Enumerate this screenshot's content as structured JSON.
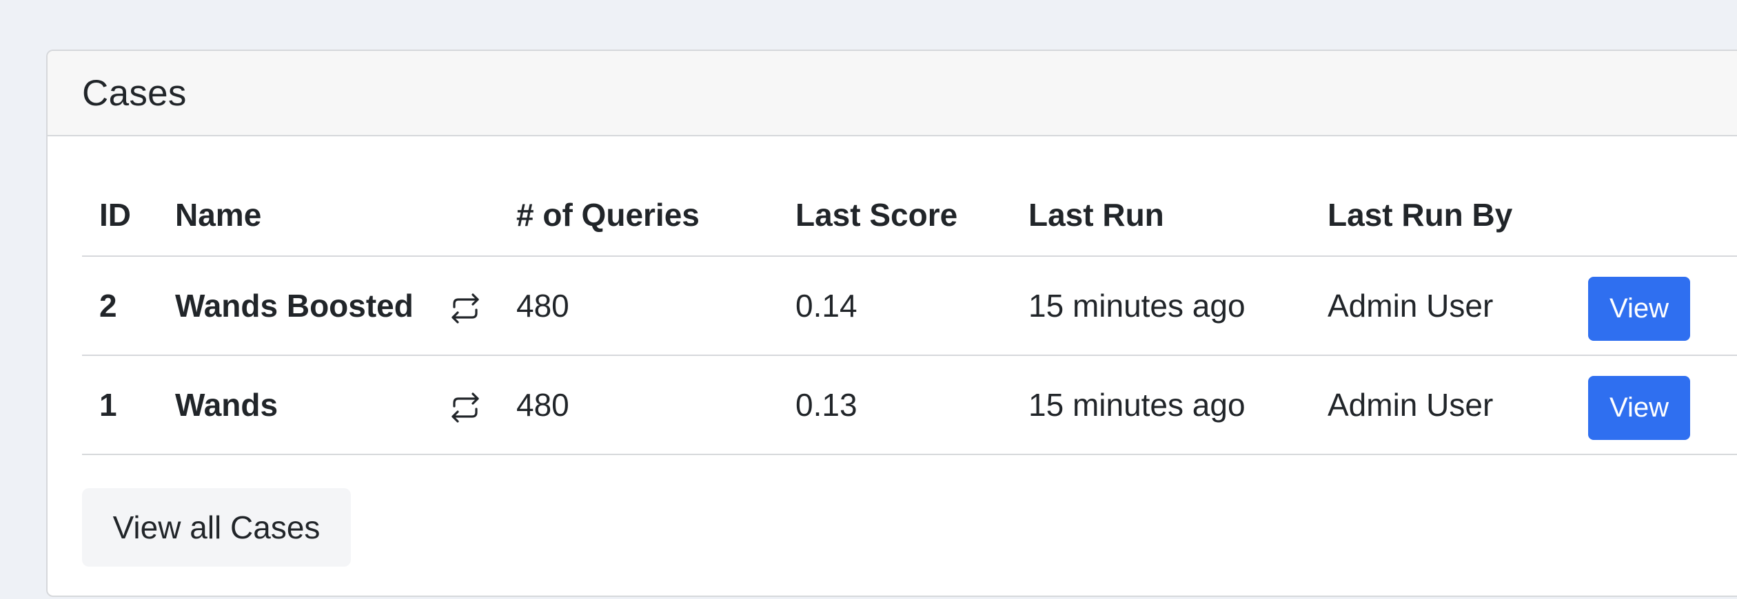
{
  "card": {
    "title": "Cases"
  },
  "table": {
    "headers": {
      "id": "ID",
      "name": "Name",
      "queries": "# of Queries",
      "last_score": "Last Score",
      "last_run": "Last Run",
      "last_run_by": "Last Run By"
    },
    "rows": [
      {
        "id": "2",
        "name": "Wands Boosted",
        "queries": "480",
        "last_score": "0.14",
        "last_run": "15 minutes ago",
        "last_run_by": "Admin User",
        "action_label": "View",
        "icon": "repeat-icon"
      },
      {
        "id": "1",
        "name": "Wands",
        "queries": "480",
        "last_score": "0.13",
        "last_run": "15 minutes ago",
        "last_run_by": "Admin User",
        "action_label": "View",
        "icon": "repeat-icon"
      }
    ]
  },
  "footer": {
    "view_all_label": "View all Cases"
  },
  "colors": {
    "primary": "#2f6ff0",
    "background": "#eef1f6",
    "border": "#d6d8db"
  }
}
